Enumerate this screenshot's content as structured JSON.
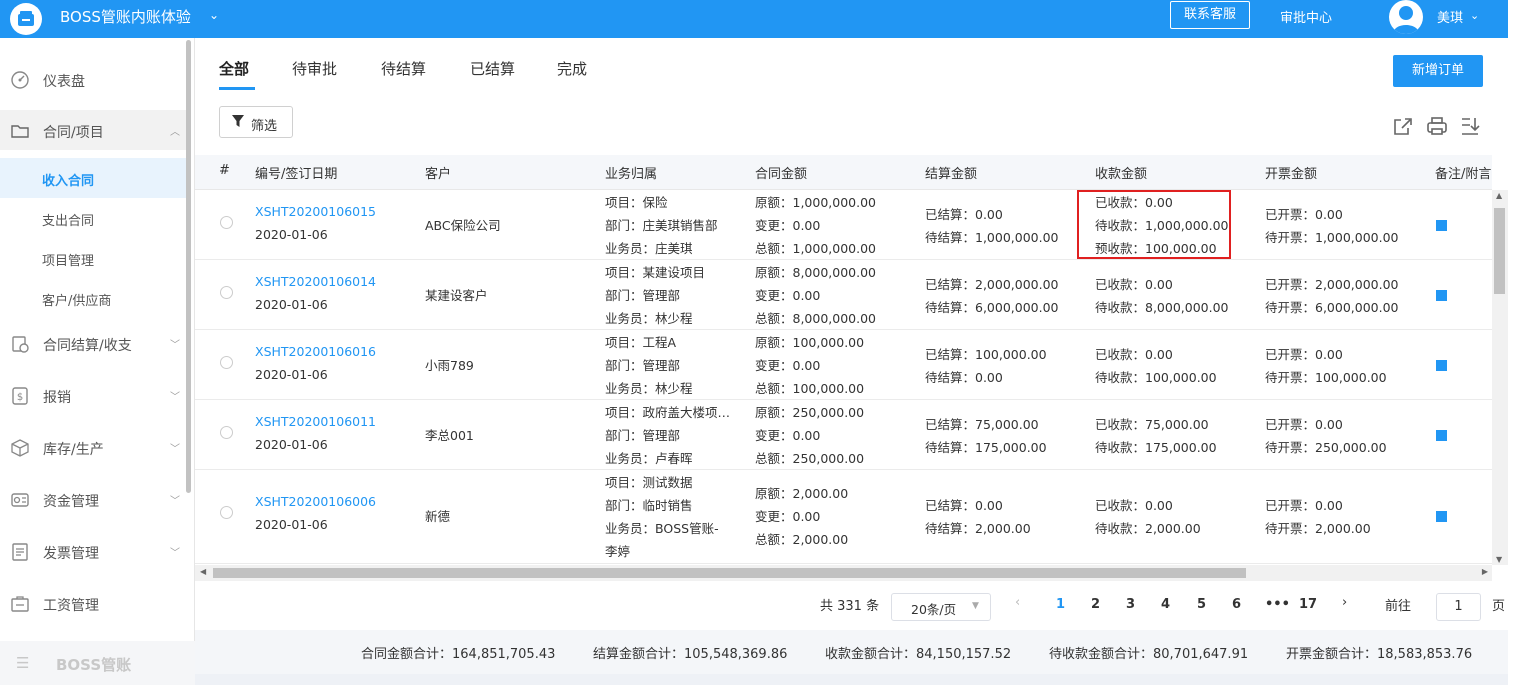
{
  "header": {
    "app_title": "BOSS管账内账体验",
    "contact_label": "联系客服",
    "approval_label": "审批中心",
    "user_name": "美琪"
  },
  "sidebar": {
    "items": [
      {
        "label": "仪表盘",
        "icon": "dashboard-icon"
      },
      {
        "label": "合同/项目",
        "icon": "folder-icon"
      },
      {
        "label": "合同结算/收支",
        "icon": "settlement-icon"
      },
      {
        "label": "报销",
        "icon": "reimburse-icon"
      },
      {
        "label": "库存/生产",
        "icon": "box-icon"
      },
      {
        "label": "资金管理",
        "icon": "fund-icon"
      },
      {
        "label": "发票管理",
        "icon": "invoice-icon"
      },
      {
        "label": "工资管理",
        "icon": "salary-icon"
      }
    ],
    "sub_items": [
      "收入合同",
      "支出合同",
      "项目管理",
      "客户/供应商"
    ],
    "bottom_label": "BOSS管账"
  },
  "tabs": [
    "全部",
    "待审批",
    "待结算",
    "已结算",
    "完成"
  ],
  "toolbar": {
    "new_order_label": "新增订单",
    "filter_label": "筛选"
  },
  "table": {
    "columns": [
      "#",
      "编号/签订日期",
      "客户",
      "业务归属",
      "合同金额",
      "结算金额",
      "收款金额",
      "开票金额",
      "备注/附言"
    ],
    "rows": [
      {
        "code": "XSHT20200106015",
        "date": "2020-01-06",
        "customer": "ABC保险公司",
        "business": [
          "项目：保险",
          "部门：庄美琪销售部",
          "业务员：庄美琪"
        ],
        "contract": [
          "原额：1,000,000.00",
          "变更：0.00",
          "总额：1,000,000.00"
        ],
        "settle": [
          "已结算：0.00",
          "待结算：1,000,000.00"
        ],
        "receipt": [
          "已收款：0.00",
          "待收款：1,000,000.00",
          "预收款：100,000.00"
        ],
        "invoice": [
          "已开票：0.00",
          "待开票：1,000,000.00"
        ]
      },
      {
        "code": "XSHT20200106014",
        "date": "2020-01-06",
        "customer": "某建设客户",
        "business": [
          "项目：某建设项目",
          "部门：管理部",
          "业务员：林少程"
        ],
        "contract": [
          "原额：8,000,000.00",
          "变更：0.00",
          "总额：8,000,000.00"
        ],
        "settle": [
          "已结算：2,000,000.00",
          "待结算：6,000,000.00"
        ],
        "receipt": [
          "已收款：0.00",
          "待收款：8,000,000.00"
        ],
        "invoice": [
          "已开票：2,000,000.00",
          "待开票：6,000,000.00"
        ]
      },
      {
        "code": "XSHT20200106016",
        "date": "2020-01-06",
        "customer": "小雨789",
        "business": [
          "项目：工程A",
          "部门：管理部",
          "业务员：林少程"
        ],
        "contract": [
          "原额：100,000.00",
          "变更：0.00",
          "总额：100,000.00"
        ],
        "settle": [
          "已结算：100,000.00",
          "待结算：0.00"
        ],
        "receipt": [
          "已收款：0.00",
          "待收款：100,000.00"
        ],
        "invoice": [
          "已开票：0.00",
          "待开票：100,000.00"
        ]
      },
      {
        "code": "XSHT20200106011",
        "date": "2020-01-06",
        "customer": "李总001",
        "business": [
          "项目：政府盖大楼项…",
          "部门：管理部",
          "业务员：卢春晖"
        ],
        "contract": [
          "原额：250,000.00",
          "变更：0.00",
          "总额：250,000.00"
        ],
        "settle": [
          "已结算：75,000.00",
          "待结算：175,000.00"
        ],
        "receipt": [
          "已收款：75,000.00",
          "待收款：175,000.00"
        ],
        "invoice": [
          "已开票：0.00",
          "待开票：250,000.00"
        ]
      },
      {
        "code": "XSHT20200106006",
        "date": "2020-01-06",
        "customer": "新德",
        "business": [
          "项目：测试数据",
          "部门：临时销售",
          "业务员：BOSS管账-",
          "李婷"
        ],
        "contract": [
          "原额：2,000.00",
          "变更：0.00",
          "总额：2,000.00"
        ],
        "settle": [
          "已结算：0.00",
          "待结算：2,000.00"
        ],
        "receipt": [
          "已收款：0.00",
          "待收款：2,000.00"
        ],
        "invoice": [
          "已开票：0.00",
          "待开票：2,000.00"
        ]
      }
    ]
  },
  "pagination": {
    "total_text": "共 331 条",
    "page_size": "20条/页",
    "pages": [
      "1",
      "2",
      "3",
      "4",
      "5",
      "6",
      "•••",
      "17"
    ],
    "current": "1",
    "goto_label": "前往",
    "goto_value": "1",
    "page_unit": "页"
  },
  "totals": [
    "合同金额合计：164,851,705.43",
    "结算金额合计：105,548,369.86",
    "收款金额合计：84,150,157.52",
    "待收款金额合计：80,701,647.91",
    "开票金额合计：18,583,853.76"
  ],
  "colors": {
    "primary": "#2196f3",
    "highlight_border": "#e02020"
  }
}
